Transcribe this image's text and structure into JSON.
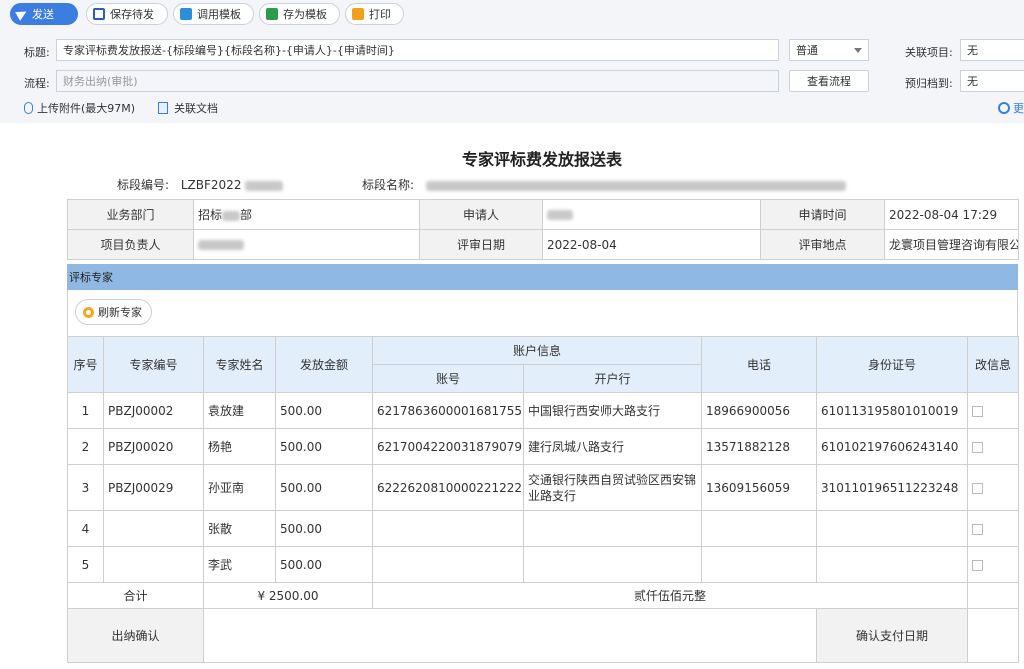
{
  "toolbar": {
    "send": "发送",
    "save_pending": "保存待发",
    "use_template": "调用模板",
    "save_template": "存为模板",
    "print": "打印"
  },
  "form": {
    "title_label": "标题:",
    "title_value": "专家评标费发放报送-{标段编号}{标段名称}-{申请人}-{申请时间}",
    "priority_value": "普通",
    "related_project_label": "关联项目:",
    "related_project_value": "无",
    "flow_label": "流程:",
    "flow_value": "财务出纳(审批)",
    "view_flow_button": "查看流程",
    "pre_archive_label": "预归档到:",
    "pre_archive_value": "无",
    "upload_attachment": "上传附件",
    "upload_limit": "(最大97M)",
    "related_doc": "关联文档",
    "more": "更"
  },
  "doc": {
    "title": "专家评标费发放报送表",
    "section_no_label": "标段编号:",
    "section_no_value": "LZBF2022",
    "section_name_label": "标段名称:",
    "info": {
      "dept_label": "业务部门",
      "dept_value": "招标",
      "dept_value_suffix": "部",
      "applicant_label": "申请人",
      "apply_time_label": "申请时间",
      "apply_time_value": "2022-08-04 17:29",
      "leader_label": "项目负责人",
      "review_date_label": "评审日期",
      "review_date_value": "2022-08-04",
      "review_place_label": "评审地点",
      "review_place_value": "龙寰项目管理咨询有限公司"
    },
    "section_experts": "评标专家",
    "refresh_button": "刷新专家",
    "headers": {
      "seq": "序号",
      "expert_no": "专家编号",
      "expert_name": "专家姓名",
      "amount": "发放金额",
      "account_info": "账户信息",
      "account_no": "账号",
      "bank": "开户行",
      "phone": "电话",
      "id_no": "身份证号",
      "modify": "改信息"
    },
    "rows": [
      {
        "seq": "1",
        "no": "PBZJ00002",
        "name": "袁放建",
        "amount": "500.00",
        "account": "6217863600001681755",
        "bank": "中国银行西安师大路支行",
        "phone": "18966900056",
        "id": "610113195801010019"
      },
      {
        "seq": "2",
        "no": "PBZJ00020",
        "name": "杨艳",
        "amount": "500.00",
        "account": "6217004220031879079",
        "bank": "建行凤城八路支行",
        "phone": "13571882128",
        "id": "610102197606243140"
      },
      {
        "seq": "3",
        "no": "PBZJ00029",
        "name": "孙亚南",
        "amount": "500.00",
        "account": "6222620810000221222",
        "bank": "交通银行陕西自贸试验区西安锦业路支行",
        "phone": "13609156059",
        "id": "310110196511223248"
      },
      {
        "seq": "4",
        "no": "",
        "name": "张散",
        "amount": "500.00",
        "account": "",
        "bank": "",
        "phone": "",
        "id": ""
      },
      {
        "seq": "5",
        "no": "",
        "name": "李武",
        "amount": "500.00",
        "account": "",
        "bank": "",
        "phone": "",
        "id": ""
      }
    ],
    "total_label": "合计",
    "total_amount": "¥ 2500.00",
    "total_words": "贰仟伍佰元整",
    "cashier_confirm": "出纳确认",
    "confirm_pay_date": "确认支付日期"
  }
}
